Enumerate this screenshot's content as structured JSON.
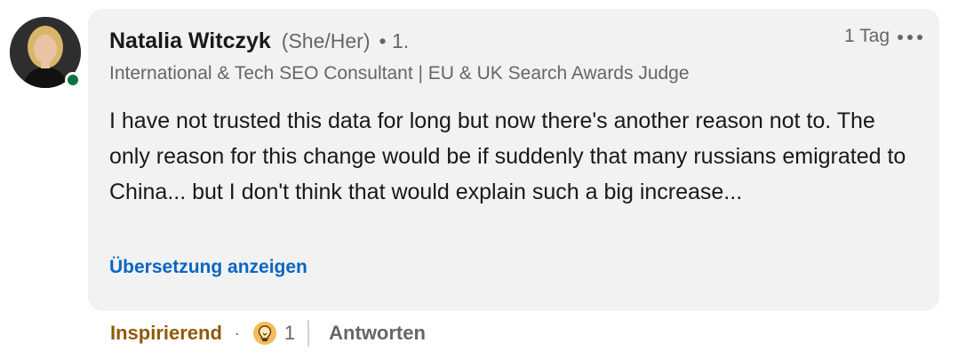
{
  "comment": {
    "author": {
      "name": "Natalia Witczyk",
      "pronouns": "(She/Her)",
      "degree": "• 1.",
      "headline": "International & Tech SEO Consultant | EU & UK Search Awards Judge",
      "online": true,
      "avatar_icon": "profile-photo"
    },
    "timestamp": "1 Tag",
    "more_icon": "ellipsis-icon",
    "text": "I have not trusted this data for long but now there's another reason not to. The only reason for this change would be if suddenly that many russians emigrated to China... but I don't think that would explain such a big increase...",
    "translate_label": "Übersetzung anzeigen"
  },
  "actions": {
    "reaction_label": "Inspirierend",
    "separator": "·",
    "reaction_icon": "lightbulb-icon",
    "reaction_count": "1",
    "reply_label": "Antworten"
  },
  "colors": {
    "box_bg": "#f2f2f2",
    "link_blue": "#0a66c2",
    "reaction_brown": "#915907",
    "online_green": "#057642",
    "muted_text": "#666666"
  }
}
